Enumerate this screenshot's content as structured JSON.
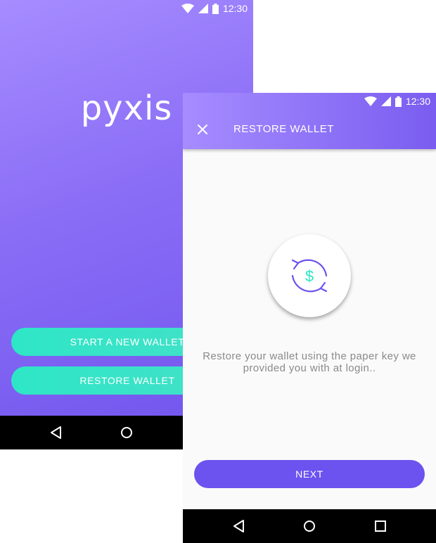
{
  "status_bar": {
    "time": "12:30"
  },
  "welcome": {
    "logo_text": "pyxis",
    "start_button": "START A NEW WALLET",
    "restore_button": "RESTORE WALLET"
  },
  "restore": {
    "title": "RESTORE WALLET",
    "description": "Restore your wallet using the paper key we provided you with at login..",
    "currency_symbol": "$",
    "next_button": "NEXT"
  },
  "icons": {
    "close": "close-icon",
    "restore": "refresh-dollar-icon",
    "back": "back-triangle-icon",
    "home": "home-circle-icon",
    "recents": "recents-square-icon"
  },
  "colors": {
    "gradient_start": "#a68cff",
    "gradient_end": "#7256ee",
    "teal": "#2ee6c6",
    "primary": "#6c52ef"
  }
}
